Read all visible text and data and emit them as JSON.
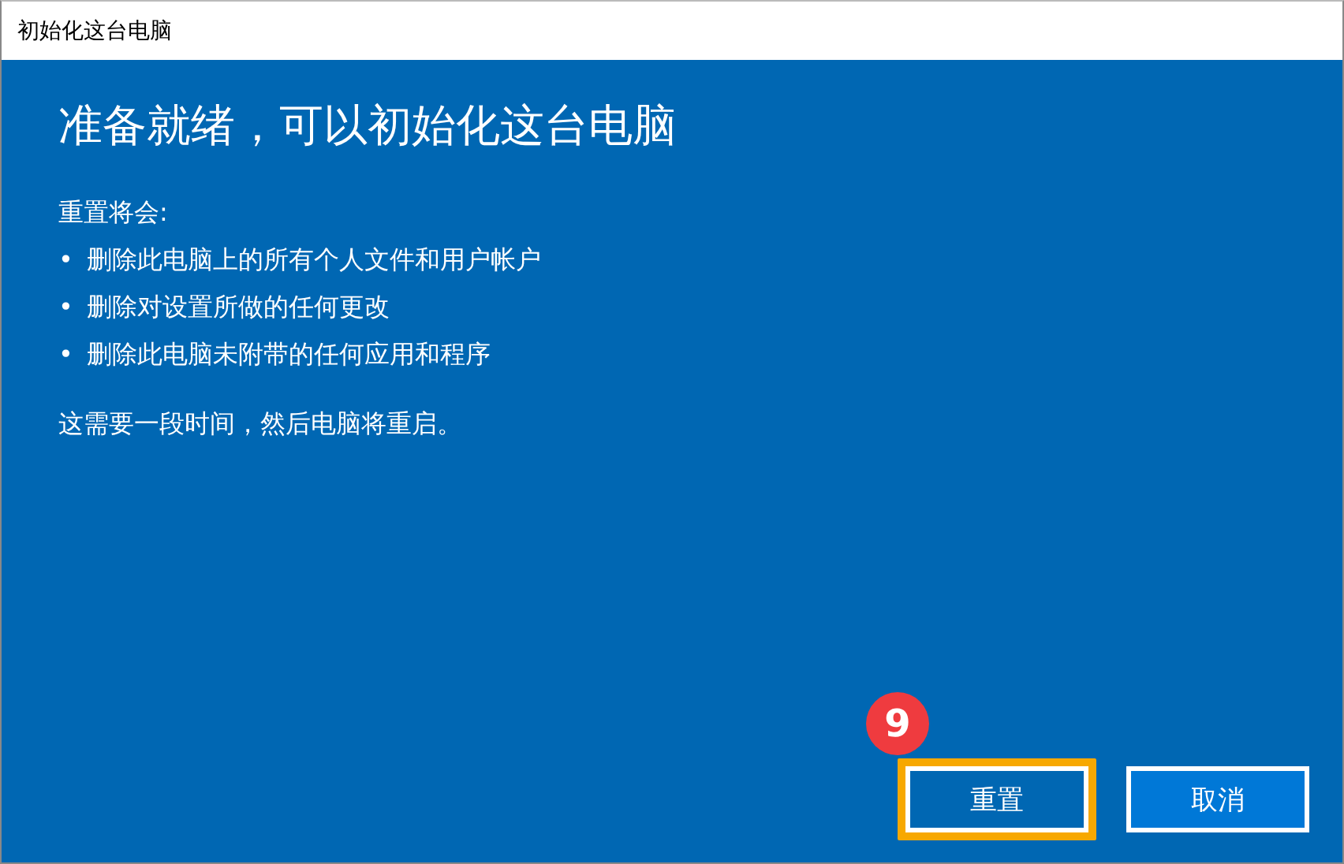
{
  "window": {
    "title": "初始化这台电脑"
  },
  "heading": "准备就绪，可以初始化这台电脑",
  "intro": "重置将会:",
  "bullets": [
    {
      "bullet": "•",
      "text": "删除此电脑上的所有个人文件和用户帐户"
    },
    {
      "bullet": "•",
      "text": "删除对设置所做的任何更改"
    },
    {
      "bullet": "•",
      "text": "删除此电脑未附带的任何应用和程序"
    }
  ],
  "note": "这需要一段时间，然后电脑将重启。",
  "buttons": [
    {
      "label": "重置",
      "focused": true,
      "highlighted": true,
      "step_badge": "9"
    },
    {
      "label": "取消",
      "focused": false,
      "highlighted": false
    }
  ]
}
